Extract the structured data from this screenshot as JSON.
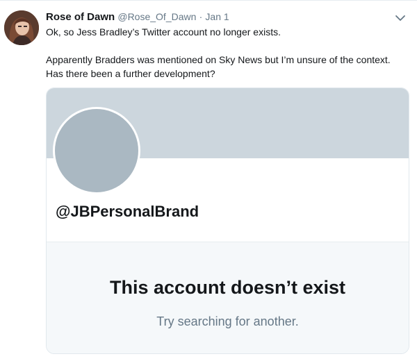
{
  "tweet": {
    "display_name": "Rose of Dawn",
    "handle": "@Rose_Of_Dawn",
    "separator": "·",
    "timestamp": "Jan 1",
    "text_line1": "Ok, so Jess Bradley’s Twitter account no longer exists.",
    "text_line2": "Apparently Bradders was mentioned on Sky News but I’m unsure of the context. Has there been a further development?"
  },
  "card": {
    "handle": "@JBPersonalBrand",
    "message": "This account doesn’t exist",
    "sub_message": "Try searching for another."
  },
  "colors": {
    "banner": "#ccd6dd",
    "avatar_placeholder": "#aab8c2",
    "secondary_text": "#657786"
  },
  "icons": {
    "caret": "chevron-down-icon"
  }
}
